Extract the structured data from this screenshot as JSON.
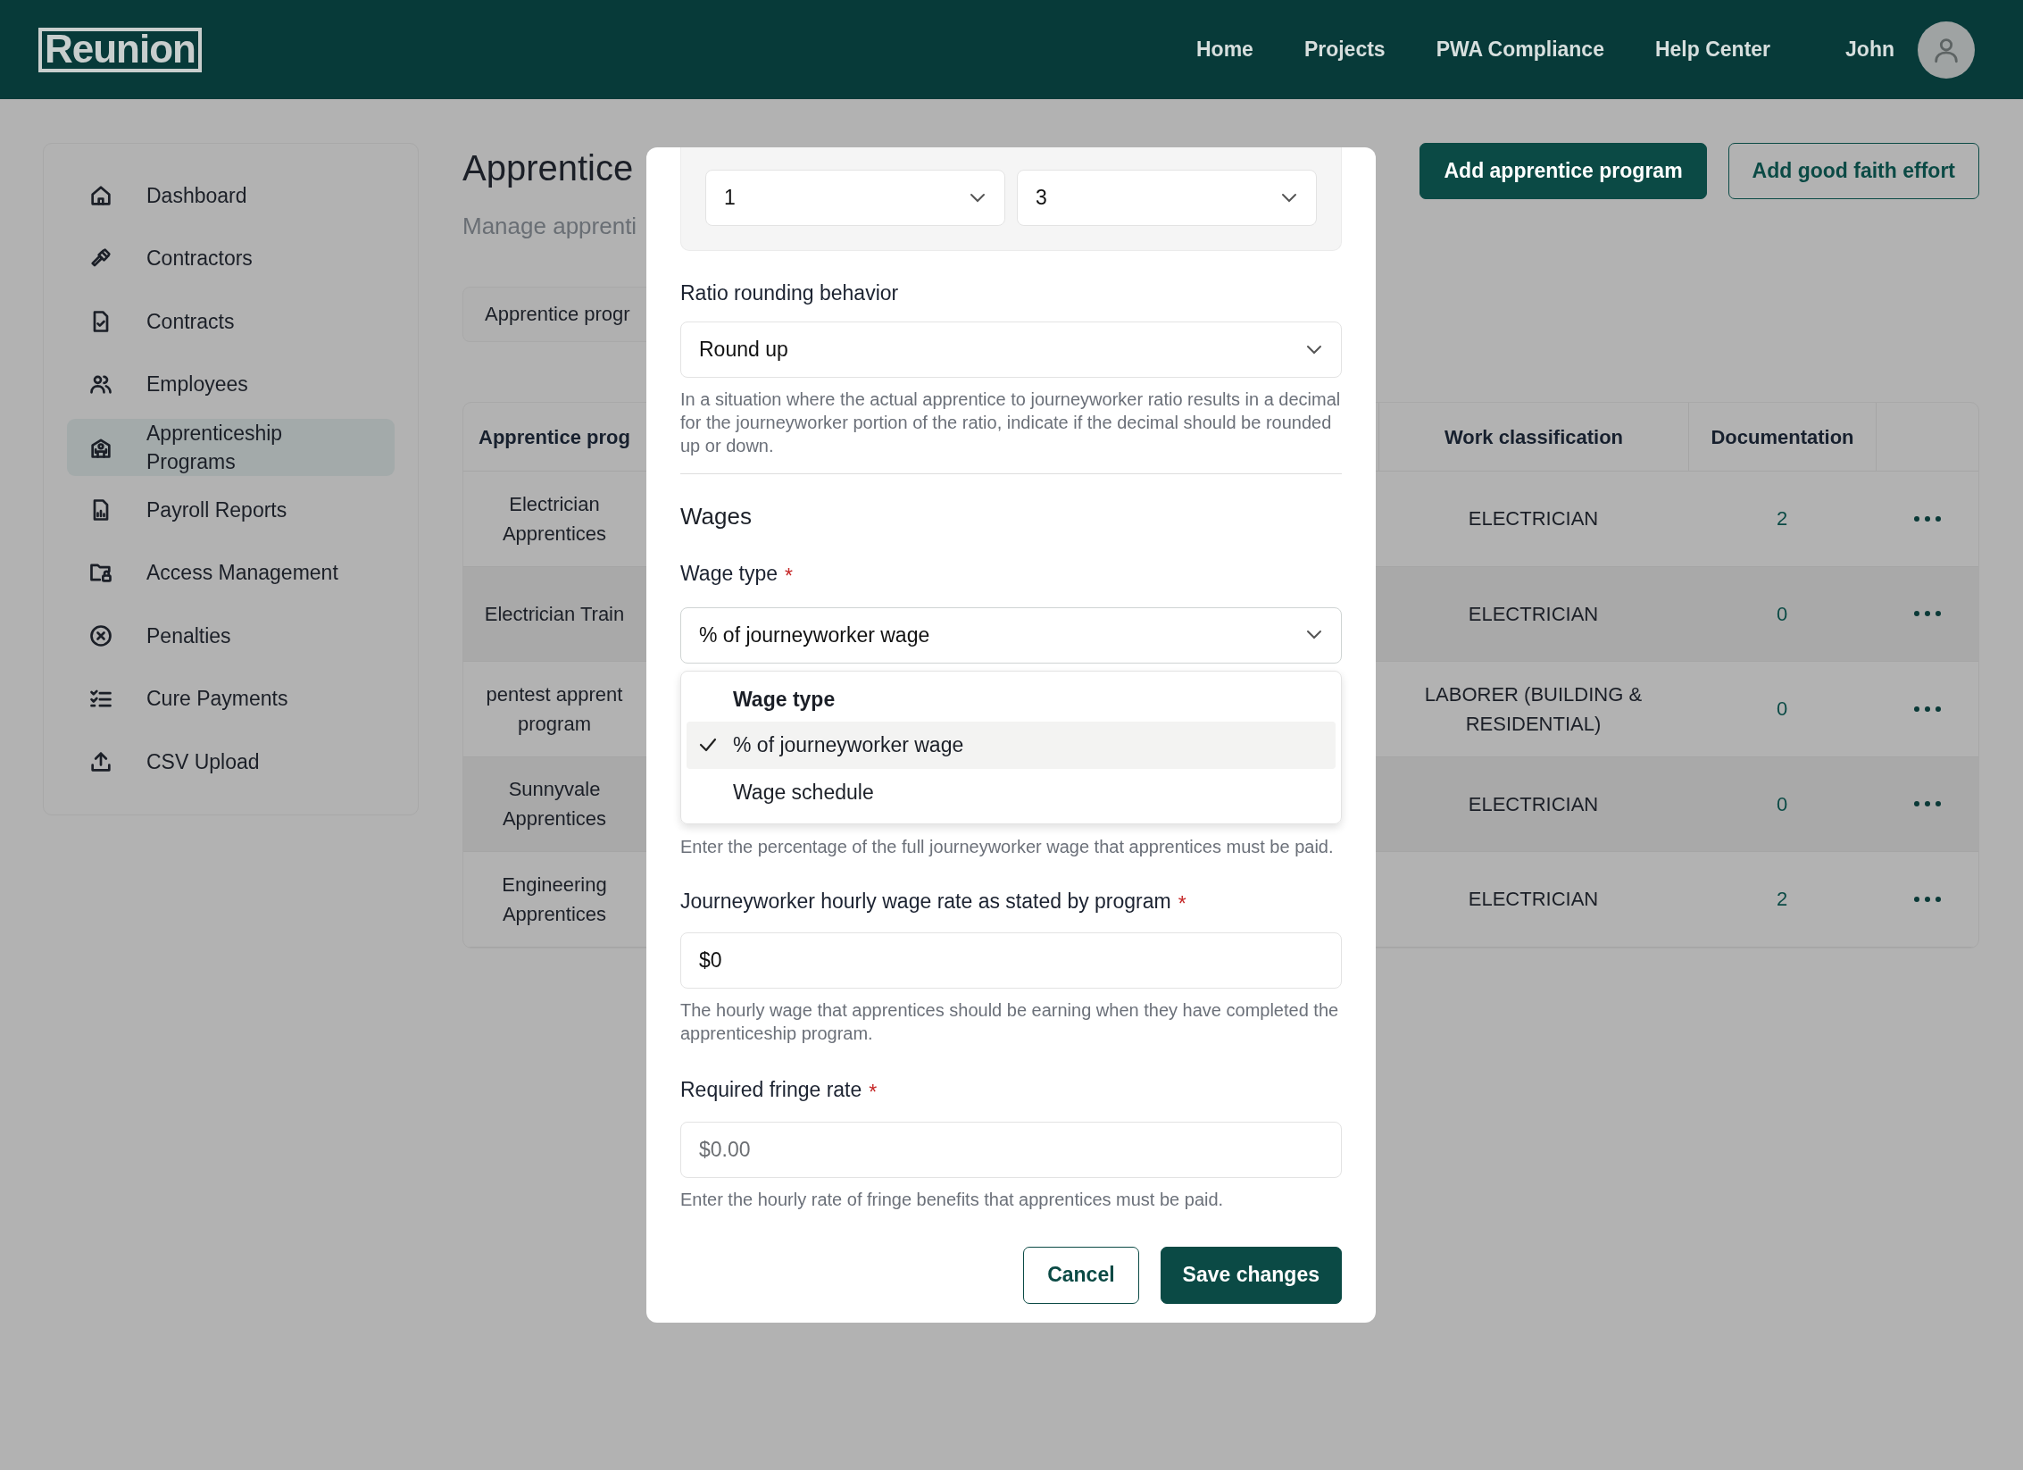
{
  "header": {
    "logo": "Reunion",
    "nav": [
      {
        "label": "Home"
      },
      {
        "label": "Projects"
      },
      {
        "label": "PWA Compliance"
      },
      {
        "label": "Help Center"
      }
    ],
    "user": "John"
  },
  "sidebar": {
    "items": [
      {
        "label": "Dashboard",
        "selected": false
      },
      {
        "label": "Contractors",
        "selected": false
      },
      {
        "label": "Contracts",
        "selected": false
      },
      {
        "label": "Employees",
        "selected": false
      },
      {
        "label": "Apprenticeship Programs",
        "selected": true
      },
      {
        "label": "Payroll Reports",
        "selected": false
      },
      {
        "label": "Access Management",
        "selected": false
      },
      {
        "label": "Penalties",
        "selected": false
      },
      {
        "label": "Cure Payments",
        "selected": false
      },
      {
        "label": "CSV Upload",
        "selected": false
      }
    ]
  },
  "page": {
    "title": "Apprentice",
    "subtitle": "Manage apprenti",
    "tab": "Apprentice progr",
    "actions": [
      {
        "label": "Add apprentice program",
        "kind": "primary"
      },
      {
        "label": "Add good faith effort",
        "kind": "outline"
      }
    ]
  },
  "table": {
    "columns": [
      "Apprentice prog",
      "Work classification",
      "Documentation"
    ],
    "rows": [
      {
        "program": "Electrician\nApprentices",
        "work_classification": "ELECTRICIAN",
        "documentation": "2"
      },
      {
        "program": "Electrician Train",
        "work_classification": "ELECTRICIAN",
        "documentation": "0"
      },
      {
        "program": "pentest apprent\nprogram",
        "work_classification": "LABORER (BUILDING & RESIDENTIAL)",
        "documentation": "0"
      },
      {
        "program": "Sunnyvale\nApprentices",
        "work_classification": "ELECTRICIAN",
        "documentation": "0"
      },
      {
        "program": "Engineering\nApprentices",
        "work_classification": "ELECTRICIAN",
        "documentation": "2"
      }
    ]
  },
  "modal": {
    "ratio": {
      "apprentices": "1",
      "journeyworkers": "3"
    },
    "rounding": {
      "label": "Ratio rounding behavior",
      "value": "Round up",
      "help": "In a situation where the actual apprentice to journeyworker ratio results in a decimal for the journeyworker portion of the ratio, indicate if the decimal should be rounded up or down."
    },
    "section": "Wages",
    "wage_type": {
      "label": "Wage type",
      "required_mark": "*",
      "value": "% of journeyworker wage",
      "expanded": true,
      "menu": {
        "heading": "Wage type",
        "options": [
          {
            "label": "% of journeyworker wage",
            "selected": true
          },
          {
            "label": "Wage schedule",
            "selected": false
          }
        ]
      }
    },
    "percentage_help": "Enter the percentage of the full journeyworker wage that apprentices must be paid.",
    "hourly": {
      "label": "Journeyworker hourly wage rate as stated by program",
      "required_mark": "*",
      "value": "$0",
      "help": "The hourly wage that apprentices should be earning when they have completed the apprenticeship program."
    },
    "fringe": {
      "label": "Required fringe rate",
      "required_mark": "*",
      "placeholder": "$0.00",
      "help": "Enter the hourly rate of fringe benefits that apprentices must be paid."
    },
    "buttons": [
      {
        "label": "Cancel",
        "kind": "secondary"
      },
      {
        "label": "Save changes",
        "kind": "primary"
      }
    ]
  }
}
